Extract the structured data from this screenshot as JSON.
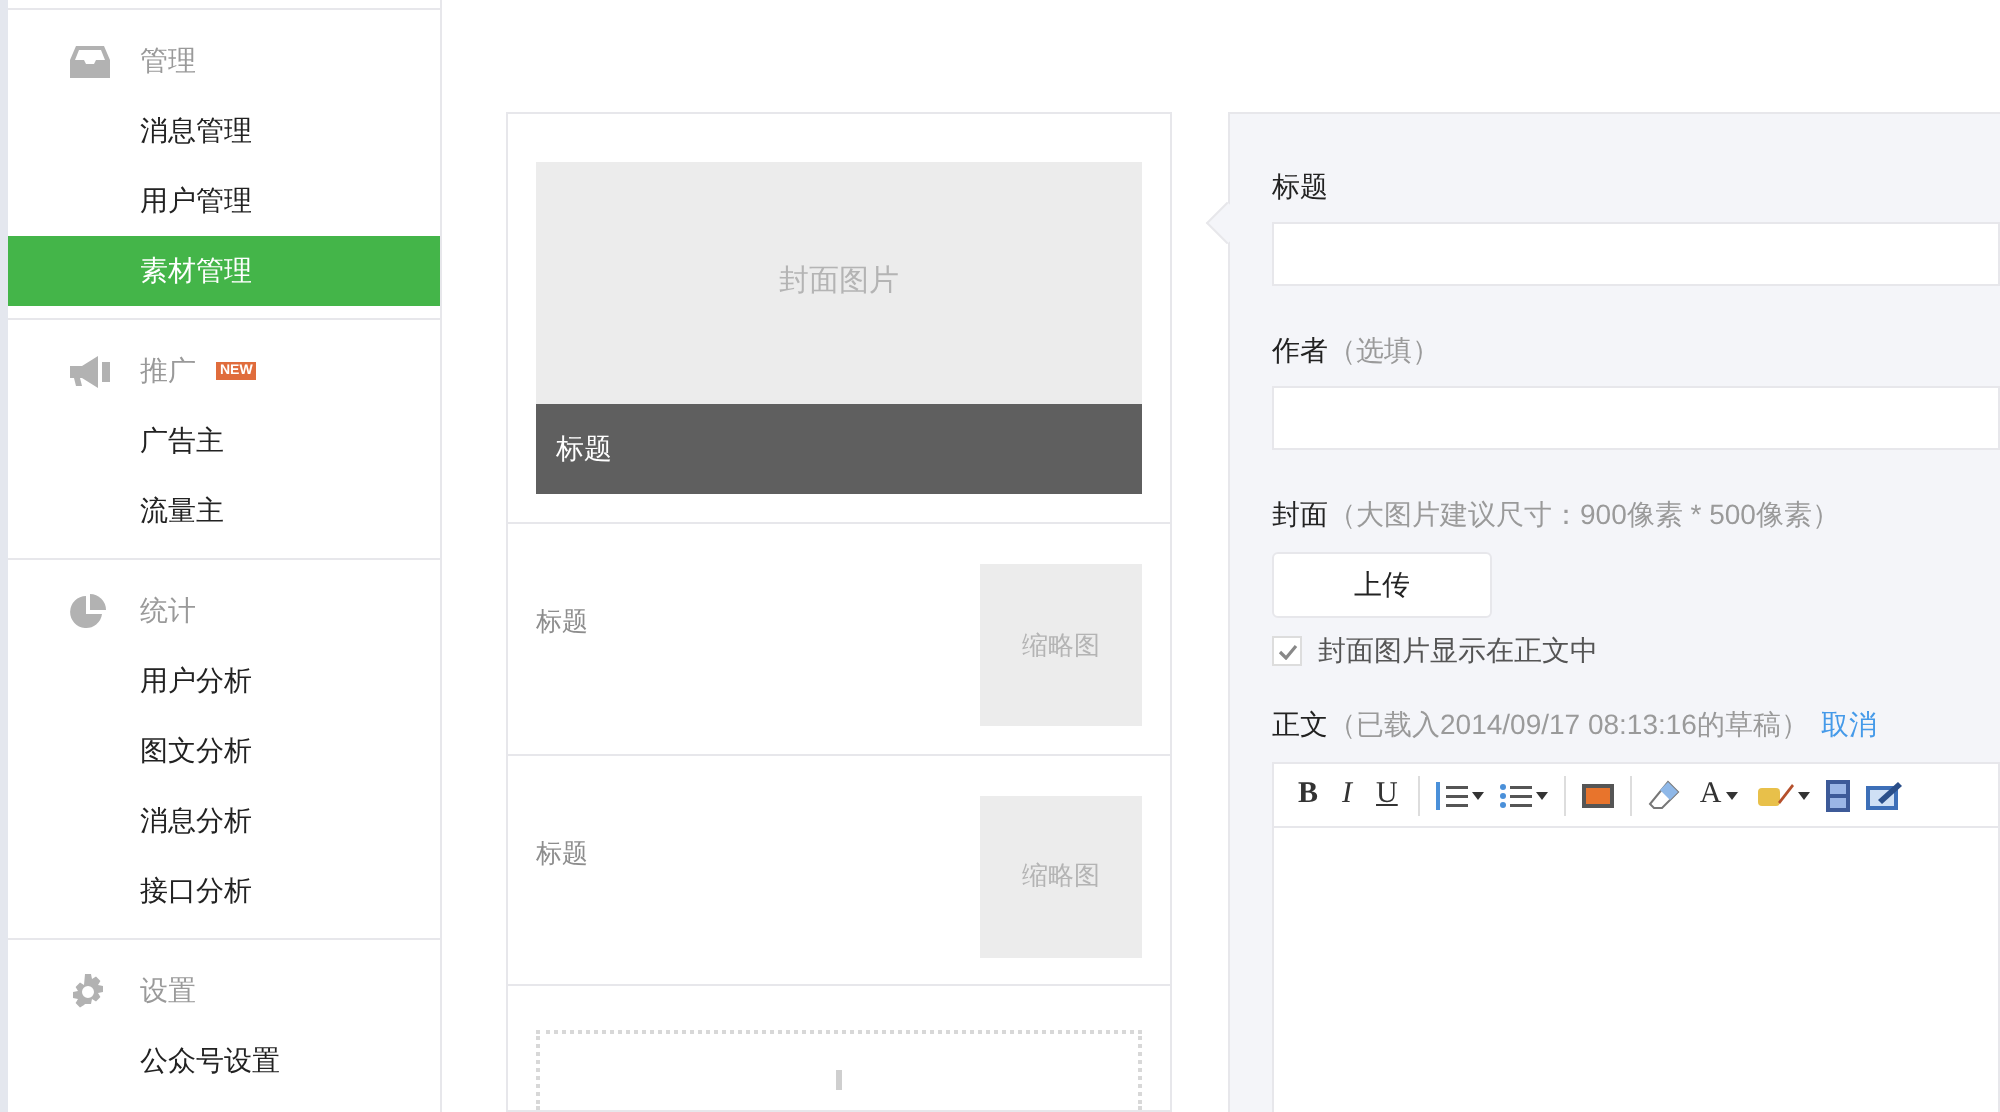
{
  "sidebar": {
    "groups": [
      {
        "title": "管理",
        "items": [
          {
            "label": "消息管理",
            "selected": false
          },
          {
            "label": "用户管理",
            "selected": false
          },
          {
            "label": "素材管理",
            "selected": true
          }
        ]
      },
      {
        "title": "推广",
        "badge": "NEW",
        "items": [
          {
            "label": "广告主",
            "selected": false
          },
          {
            "label": "流量主",
            "selected": false
          }
        ]
      },
      {
        "title": "统计",
        "items": [
          {
            "label": "用户分析",
            "selected": false
          },
          {
            "label": "图文分析",
            "selected": false
          },
          {
            "label": "消息分析",
            "selected": false
          },
          {
            "label": "接口分析",
            "selected": false
          }
        ]
      },
      {
        "title": "设置",
        "items": [
          {
            "label": "公众号设置",
            "selected": false
          }
        ]
      }
    ]
  },
  "articles": {
    "cover": {
      "placeholder": "封面图片",
      "title": "标题"
    },
    "items": [
      {
        "title": "标题",
        "thumbnail": "缩略图"
      },
      {
        "title": "标题",
        "thumbnail": "缩略图"
      }
    ]
  },
  "editor": {
    "title_field": {
      "label": "标题"
    },
    "author_field": {
      "label": "作者",
      "hint": "（选填）"
    },
    "cover": {
      "label": "封面",
      "hint": "（大图片建议尺寸：900像素 * 500像素）",
      "button": "上传",
      "checkbox": {
        "label": "封面图片显示在正文中",
        "checked": true
      }
    },
    "body": {
      "label": "正文",
      "hint": "（已载入2014/09/17 08:13:16的草稿）",
      "link": "取消"
    },
    "toolbar": [
      {
        "kind": "bold",
        "label": "B"
      },
      {
        "kind": "italic",
        "label": "I"
      },
      {
        "kind": "underline",
        "label": "U"
      },
      {
        "kind": "divider"
      },
      {
        "kind": "numbered",
        "dropdown": true
      },
      {
        "kind": "bulleted",
        "dropdown": true
      },
      {
        "kind": "divider"
      },
      {
        "kind": "image",
        "dropdown": false
      },
      {
        "kind": "divider"
      },
      {
        "kind": "eraser",
        "dropdown": false
      },
      {
        "kind": "color",
        "label": "A",
        "dropdown": true
      },
      {
        "kind": "highlight",
        "dropdown": true
      },
      {
        "kind": "video",
        "dropdown": false
      },
      {
        "kind": "frame",
        "dropdown": false
      }
    ]
  }
}
